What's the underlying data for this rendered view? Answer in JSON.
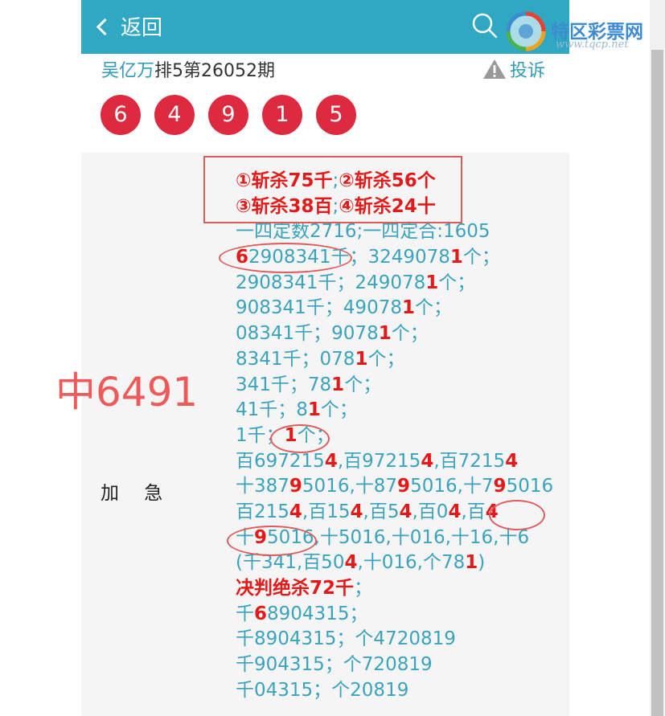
{
  "header": {
    "back_label": "返回",
    "logo_text": "特区彩票网",
    "logo_url": "www.tqcp.net"
  },
  "article": {
    "author": "吴亿万",
    "issue": "排5第26052期",
    "complaint_label": "投诉",
    "balls": [
      "6",
      "4",
      "9",
      "1",
      "5"
    ]
  },
  "overlay_text": "中6491",
  "row_label": "加 急",
  "content_lines": [
    [
      {
        "t": "①斩杀75千",
        "r": true
      },
      {
        "t": ";"
      },
      {
        "t": "②斩杀56个",
        "r": true
      }
    ],
    [
      {
        "t": "③斩杀38百",
        "r": true
      },
      {
        "t": ";"
      },
      {
        "t": "④斩杀24十",
        "r": true
      }
    ],
    [
      {
        "t": "一四定数2716;一四定合:1605"
      }
    ],
    [
      {
        "t": "6",
        "r": true
      },
      {
        "t": "2908341千；3249078"
      },
      {
        "t": "1",
        "r": true
      },
      {
        "t": "个；"
      }
    ],
    [
      {
        "t": "2908341千；249078"
      },
      {
        "t": "1",
        "r": true
      },
      {
        "t": "个；"
      }
    ],
    [
      {
        "t": "908341千；49078"
      },
      {
        "t": "1",
        "r": true
      },
      {
        "t": "个；"
      }
    ],
    [
      {
        "t": "08341千；9078"
      },
      {
        "t": "1",
        "r": true
      },
      {
        "t": "个；"
      }
    ],
    [
      {
        "t": "8341千；078"
      },
      {
        "t": "1",
        "r": true
      },
      {
        "t": "个；"
      }
    ],
    [
      {
        "t": "341千；78"
      },
      {
        "t": "1",
        "r": true
      },
      {
        "t": "个；"
      }
    ],
    [
      {
        "t": "41千；8"
      },
      {
        "t": "1",
        "r": true
      },
      {
        "t": "个；"
      }
    ],
    [
      {
        "t": "1千；"
      },
      {
        "t": "1",
        "r": true
      },
      {
        "t": "个；"
      }
    ],
    [
      {
        "t": "百697215"
      },
      {
        "t": "4",
        "r": true
      },
      {
        "t": ",百97215"
      },
      {
        "t": "4",
        "r": true
      },
      {
        "t": ",百7215"
      },
      {
        "t": "4",
        "r": true
      }
    ],
    [
      {
        "t": "十387"
      },
      {
        "t": "9",
        "r": true
      },
      {
        "t": "5016,十87"
      },
      {
        "t": "9",
        "r": true
      },
      {
        "t": "5016,十7"
      },
      {
        "t": "9",
        "r": true
      },
      {
        "t": "5016"
      }
    ],
    [
      {
        "t": "百215"
      },
      {
        "t": "4",
        "r": true
      },
      {
        "t": ",百15"
      },
      {
        "t": "4",
        "r": true
      },
      {
        "t": ",百5"
      },
      {
        "t": "4",
        "r": true
      },
      {
        "t": ",百0"
      },
      {
        "t": "4",
        "r": true
      },
      {
        "t": ",百"
      },
      {
        "t": "4",
        "r": true
      }
    ],
    [
      {
        "t": "十"
      },
      {
        "t": "9",
        "r": true
      },
      {
        "t": "5016,十5016,十016,十16,十6"
      }
    ],
    [
      {
        "t": "(千341,百50"
      },
      {
        "t": "4",
        "r": true
      },
      {
        "t": ",十016,个78"
      },
      {
        "t": "1",
        "r": true
      },
      {
        "t": ")"
      }
    ],
    [
      {
        "t": "决判绝杀72千",
        "r": true
      },
      {
        "t": "；"
      }
    ],
    [
      {
        "t": "千"
      },
      {
        "t": "6",
        "r": true
      },
      {
        "t": "8904315；"
      }
    ],
    [
      {
        "t": "千8904315；个472081"
      },
      {
        "t": "9"
      }
    ],
    [
      {
        "t": "千904315；个72081"
      },
      {
        "t": "9"
      }
    ],
    [
      {
        "t": "千04315；个2081"
      },
      {
        "t": "9"
      }
    ]
  ],
  "colors": {
    "header_bg": "#30a8c3",
    "ball_bg": "#dd2a3e",
    "link": "#2f9bb5",
    "highlight": "#e41a1a",
    "overlay": "#ed5a5a"
  }
}
